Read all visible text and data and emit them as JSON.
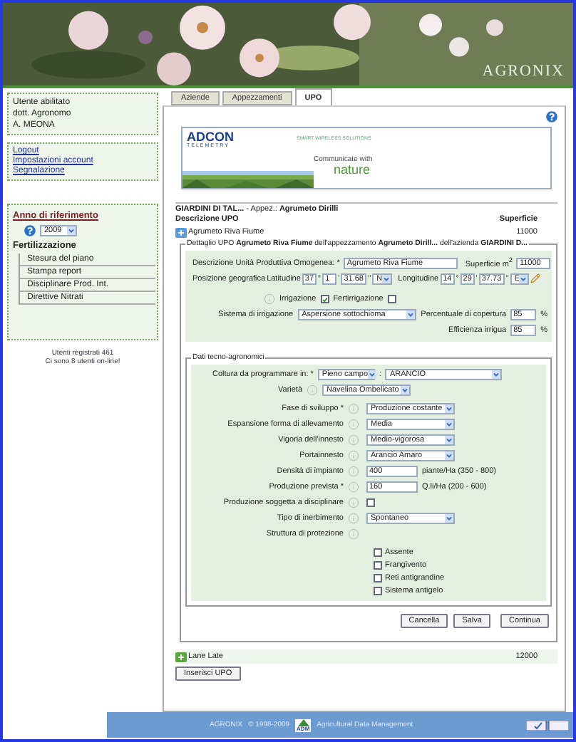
{
  "header": {
    "logo": "AGRONIX"
  },
  "sidebar": {
    "user": [
      "Utente abilitato",
      "dott. Agronomo",
      "A. MEONA"
    ],
    "links": [
      "Logout",
      "Impostazioni account",
      "Segnalazione"
    ],
    "year_panel": {
      "title": "Anno di riferimento",
      "year": "2009",
      "section": "Fertilizzazione",
      "items": [
        "Stesura del piano",
        "Stampa report",
        "Disciplinare Prod. Int.",
        "Direttive Nitrati"
      ]
    },
    "stats": [
      "Utenti registrati 461",
      "Ci sono 8 utenti on-line!"
    ]
  },
  "tabs": [
    {
      "label": "Aziende",
      "selected": false
    },
    {
      "label": "Appezzamenti",
      "selected": false
    },
    {
      "label": "UPO",
      "selected": true
    }
  ],
  "banner": {
    "brand": "ADCON",
    "sub": "TELEMETRY",
    "tagline": "SMART WIRELESS SOLUTIONS",
    "slogan": "Communicate with",
    "slogan_big": "nature"
  },
  "form": {
    "heading": "**GIARDINI DI TAL...** - Appez.: **Agrumeto Dirilli**",
    "columns": [
      "Descrizione UPO",
      "Superficie"
    ],
    "upo_rows": [
      {
        "name": "Agrumeto Riva Fiume",
        "area": "11000",
        "expanded": true
      },
      {
        "name": "Lane Late",
        "area": "12000",
        "expanded": false
      }
    ],
    "detail": {
      "legend": "Dettaglio UPO **Agrumeto Riva Fiume** dell'appezzamento **Agrumeto Dirill...** dell'azienda **GIARDINI D...**",
      "desc_label": "Descrizione Unità Produttiva Omogenea: *",
      "desc_value": "Agrumeto Riva Fiume",
      "area_label": "Superficie m$^{2}$",
      "area_value": "11000",
      "position_label": "Posizione geografica",
      "lat_label": "Latitudine",
      "lat": [
        "37",
        "1",
        "31.68"
      ],
      "lat_dir": "N",
      "lon_label": "Longitudine",
      "lon": [
        "14",
        "29",
        "37.73"
      ],
      "lon_dir": "E",
      "units": [
        "°",
        "'",
        "\""
      ],
      "irrigation": {
        "label": "Irrigazione",
        "checked": true
      },
      "fertirrigation": {
        "label": "Fertirrigazione",
        "checked": false
      },
      "system_label": "Sistema di irrigazione",
      "system_value": "Aspersione sottochioma",
      "coverage_label": "Percentuale di copertura",
      "coverage_value": "85",
      "efficiency_label": "Efficienza irrigua",
      "efficiency_value": "85",
      "percent": "%"
    },
    "tech": {
      "legend": "Dati tecno-agronomici",
      "crop": {
        "label": "Coltura da programmare in: *",
        "mode": "Pieno campo",
        "sep": ":",
        "crop": "ARANCIO"
      },
      "variety": {
        "label": "Varietà",
        "value": "Navelina Ombelicato"
      },
      "rows": [
        {
          "kind": "select",
          "label": "Fase di sviluppo *",
          "value": "Produzione costante"
        },
        {
          "kind": "select",
          "label": "Espansione forma di allevamento",
          "value": "Media"
        },
        {
          "kind": "select",
          "label": "Vigoria dell'innesto",
          "value": "Medio-vigorosa"
        },
        {
          "kind": "select",
          "label": "Portainnesto",
          "value": "Arancio Amaro"
        },
        {
          "kind": "input",
          "label": "Densità di impianto",
          "value": "400",
          "hint": "piante/Ha (350 - 800)"
        },
        {
          "kind": "input",
          "label": "Produzione prevista *",
          "value": "160",
          "hint": "Q.li/Ha (200 - 600)"
        },
        {
          "kind": "checkbox",
          "label": "Produzione soggetta a disciplinare",
          "checked": false
        },
        {
          "kind": "select",
          "label": "Tipo di inerbimento",
          "value": "Spontaneo"
        },
        {
          "kind": "none",
          "label": "Struttura di protezione"
        }
      ],
      "options": [
        {
          "label": "Assente",
          "checked": false
        },
        {
          "label": "Frangivento",
          "checked": false
        },
        {
          "label": "Reti antigrandine",
          "checked": false
        },
        {
          "label": "Sistema antigelo",
          "checked": false
        }
      ]
    },
    "buttons": [
      "Cancella",
      "Salva",
      "Continua"
    ],
    "insert_button": "Inserisci UPO"
  },
  "footer": {
    "brand": "AGRONIX",
    "copyright": "© 1998-2009",
    "logo": "ADM",
    "tagline": "Agricultural Data Management"
  }
}
